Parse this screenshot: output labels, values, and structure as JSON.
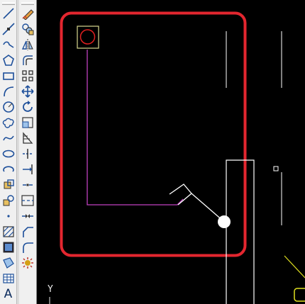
{
  "draw_toolbar": {
    "tools": [
      {
        "name": "line-tool-icon"
      },
      {
        "name": "construction-line-icon"
      },
      {
        "name": "polyline-icon"
      },
      {
        "name": "polygon-icon"
      },
      {
        "name": "rectangle-icon"
      },
      {
        "name": "arc-icon"
      },
      {
        "name": "circle-icon"
      },
      {
        "name": "revision-cloud-icon"
      },
      {
        "name": "spline-icon"
      },
      {
        "name": "ellipse-icon"
      },
      {
        "name": "ellipse-arc-icon"
      },
      {
        "name": "insert-block-icon"
      },
      {
        "name": "make-block-icon"
      },
      {
        "name": "point-icon"
      },
      {
        "name": "hatch-icon"
      },
      {
        "name": "gradient-icon"
      },
      {
        "name": "region-icon"
      },
      {
        "name": "table-icon"
      },
      {
        "name": "multiline-text-icon",
        "glyph": "A"
      }
    ]
  },
  "modify_toolbar": {
    "tools": [
      {
        "name": "erase-icon"
      },
      {
        "name": "copy-icon"
      },
      {
        "name": "mirror-icon"
      },
      {
        "name": "offset-icon"
      },
      {
        "name": "array-icon"
      },
      {
        "name": "move-icon"
      },
      {
        "name": "rotate-icon"
      },
      {
        "name": "scale-icon"
      },
      {
        "name": "stretch-icon"
      },
      {
        "name": "trim-icon"
      },
      {
        "name": "extend-icon"
      },
      {
        "name": "break-at-point-icon"
      },
      {
        "name": "break-icon"
      },
      {
        "name": "join-icon"
      },
      {
        "name": "chamfer-icon"
      },
      {
        "name": "fillet-icon"
      },
      {
        "name": "explode-icon"
      }
    ]
  },
  "canvas": {
    "ucs_axis_label": "Y",
    "colors": {
      "background": "#000000",
      "highlight_box": "#e3262f",
      "polyline": "#c040c0",
      "lines": "#ffffff",
      "marker_square": "#d8d890",
      "marker_circle": "#e02020",
      "yellow_line": "#e0e020"
    }
  }
}
